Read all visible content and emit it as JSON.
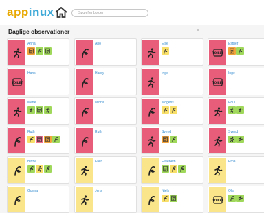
{
  "app": {
    "logo_part1": "app",
    "logo_part2": "inux"
  },
  "search": {
    "placeholder": "Søg efter borger"
  },
  "section": {
    "title": "Daglige observationer"
  },
  "cards": [
    {
      "name": "Anna",
      "side": "red",
      "icon": "runner-icon",
      "tags": [
        [
          "o",
          "document-icon"
        ],
        [
          "g",
          "sprout-icon"
        ],
        [
          "g",
          "document-icon"
        ]
      ]
    },
    {
      "name": "Ano",
      "side": "red",
      "icon": "sprout-icon",
      "tags": []
    },
    {
      "name": "Else",
      "side": "red",
      "icon": "runner-icon",
      "tags": [
        [
          "y",
          "sprout-icon"
        ]
      ]
    },
    {
      "name": "Esther",
      "side": "red",
      "icon": "toilet-icon",
      "tags": [
        [
          "o",
          "document-icon"
        ],
        [
          "g",
          "sprout-icon"
        ]
      ]
    },
    {
      "name": "Hans",
      "side": "red",
      "icon": "toilet-icon",
      "tags": []
    },
    {
      "name": "Hardy",
      "side": "red",
      "icon": "sprout-icon",
      "tags": []
    },
    {
      "name": "Inge",
      "side": "red",
      "icon": "runner-icon",
      "tags": []
    },
    {
      "name": "Inge",
      "side": "red",
      "icon": "toilet-icon",
      "tags": []
    },
    {
      "name": "Mette",
      "side": "red",
      "icon": "runner-icon",
      "tags": [
        [
          "g",
          "runner-icon"
        ],
        [
          "g",
          "document-icon"
        ],
        [
          "g",
          "runner-icon"
        ]
      ]
    },
    {
      "name": "Minna",
      "side": "red",
      "icon": "sprout-icon",
      "tags": []
    },
    {
      "name": "Mogens",
      "side": "red",
      "icon": "sprout-icon",
      "tags": [
        [
          "y",
          "sprout-icon"
        ],
        [
          "y",
          "sprout-icon"
        ]
      ]
    },
    {
      "name": "Poul",
      "side": "red",
      "icon": "runner-icon",
      "tags": [
        [
          "g",
          "runner-icon"
        ],
        [
          "g",
          "runner-icon"
        ]
      ]
    },
    {
      "name": "Ruth",
      "side": "red",
      "icon": "sprout-icon",
      "tags": [
        [
          "y",
          "sprout-icon"
        ],
        [
          "p",
          "document-icon"
        ],
        [
          "o",
          "document-icon"
        ],
        [
          "g",
          "sprout-icon"
        ]
      ]
    },
    {
      "name": "Ruth",
      "side": "red",
      "icon": "sprout-icon",
      "tags": []
    },
    {
      "name": "Svend",
      "side": "red",
      "icon": "runner-icon",
      "tags": [
        [
          "o",
          "document-icon"
        ],
        [
          "g",
          "sprout-icon"
        ]
      ]
    },
    {
      "name": "Svend",
      "side": "red",
      "icon": "runner-icon",
      "tags": [
        [
          "g",
          "runner-icon"
        ],
        [
          "g",
          "runner-icon"
        ]
      ]
    },
    {
      "name": "Birthe",
      "side": "yellow",
      "icon": "sprout-icon",
      "tags": [
        [
          "g",
          "sprout-icon"
        ],
        [
          "y",
          "runner-icon"
        ],
        [
          "g",
          "sprout-icon"
        ]
      ]
    },
    {
      "name": "Ellen",
      "side": "yellow",
      "icon": "runner-icon",
      "tags": []
    },
    {
      "name": "Elisebeth",
      "side": "yellow",
      "icon": "sprout-icon",
      "tags": [
        [
          "g",
          "document-icon"
        ],
        [
          "y",
          "sprout-icon"
        ],
        [
          "g",
          "sprout-icon"
        ]
      ]
    },
    {
      "name": "Erna",
      "side": "yellow",
      "icon": "runner-icon",
      "tags": []
    },
    {
      "name": "Gunnar",
      "side": "yellow",
      "icon": "sprout-icon",
      "tags": []
    },
    {
      "name": "Jens",
      "side": "yellow",
      "icon": "runner-icon",
      "tags": []
    },
    {
      "name": "Niels",
      "side": "yellow",
      "icon": "sprout-icon",
      "tags": [
        [
          "y",
          "sprout-icon"
        ],
        [
          "g",
          "document-icon"
        ]
      ]
    },
    {
      "name": "Olla",
      "side": "yellow",
      "icon": "toilet-icon",
      "tags": [
        [
          "g",
          "sprout-icon"
        ],
        [
          "g",
          "runner-icon"
        ]
      ]
    }
  ],
  "toilet_label": "TOILET",
  "colors": {
    "red": "#e85d7a",
    "yellow": "#fbe58a",
    "green": "#9fd85a",
    "orange": "#f2a33a",
    "link": "#3a8fd0"
  }
}
